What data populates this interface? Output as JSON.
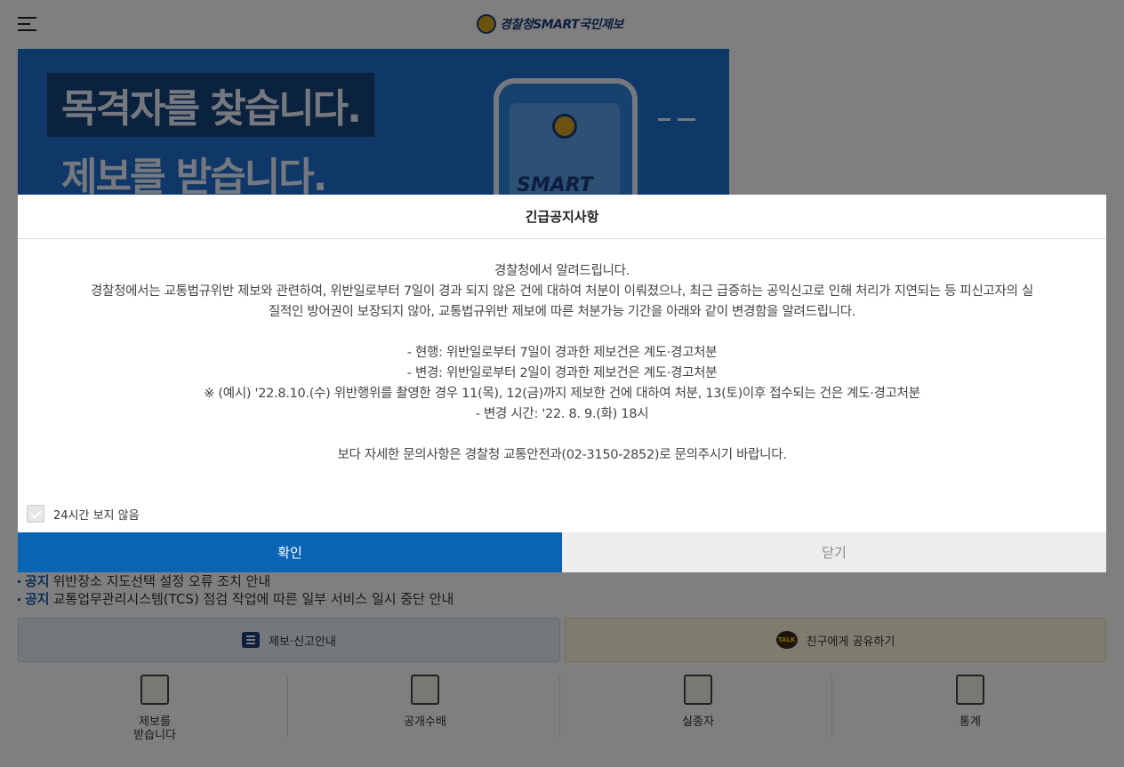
{
  "header": {
    "logo_text": "경찰청SMART국민제보"
  },
  "banner": {
    "line1": "목격자를 찾습니다.",
    "line2": "제보를 받습니다.",
    "phone_text": "SMART"
  },
  "notices": [
    {
      "tag": "공지",
      "text": "위반장소 지도선택 설정 오류 조치 안내"
    },
    {
      "tag": "공지",
      "text": "교통업무관리시스템(TCS) 점검 작업에 따른 일부 서비스 일시 중단 안내"
    }
  ],
  "actions": {
    "guide_label": "제보·신고안내",
    "share_label": "친구에게 공유하기",
    "talk_icon_text": "TALK"
  },
  "quick_menu": [
    {
      "label": "제보를\n받습니다",
      "icon": "report-phone-icon"
    },
    {
      "label": "공개수배",
      "icon": "wanted-poster-icon"
    },
    {
      "label": "실종자",
      "icon": "missing-poster-icon"
    },
    {
      "label": "통계",
      "icon": "statistics-icon"
    }
  ],
  "modal": {
    "title": "긴급공지사항",
    "lines": [
      "경찰청에서 알려드립니다.",
      "경찰청에서는 교통법규위반 제보와 관련하여, 위반일로부터 7일이 경과 되지 않은 건에 대하여 처분이 이뤄졌으나, 최근 급증하는 공익신고로 인해 처리가 지연되는 등 피신고자의 실",
      "질적인 방어권이 보장되지 않아, 교통법규위반 제보에 따른 처분가능 기간을 아래와 같이 변경함을 알려드립니다.",
      "",
      "- 현행: 위반일로부터 7일이 경과한 제보건은 계도·경고처분",
      "- 변경: 위반일로부터 2일이 경과한 제보건은 계도·경고처분",
      "※ (예시) '22.8.10.(수) 위반행위를 촬영한 경우 11(목), 12(금)까지 제보한 건에 대하여 처분, 13(토)이후 접수되는 건은 계도·경고처분",
      "- 변경 시간: '22. 8. 9.(화) 18시",
      "",
      "보다 자세한 문의사항은 경찰청 교통안전과(02-3150-2852)로 문의주시기 바랍니다."
    ],
    "checkbox_label": "24시간 보지 않음",
    "confirm_label": "확인",
    "close_label": "닫기"
  }
}
